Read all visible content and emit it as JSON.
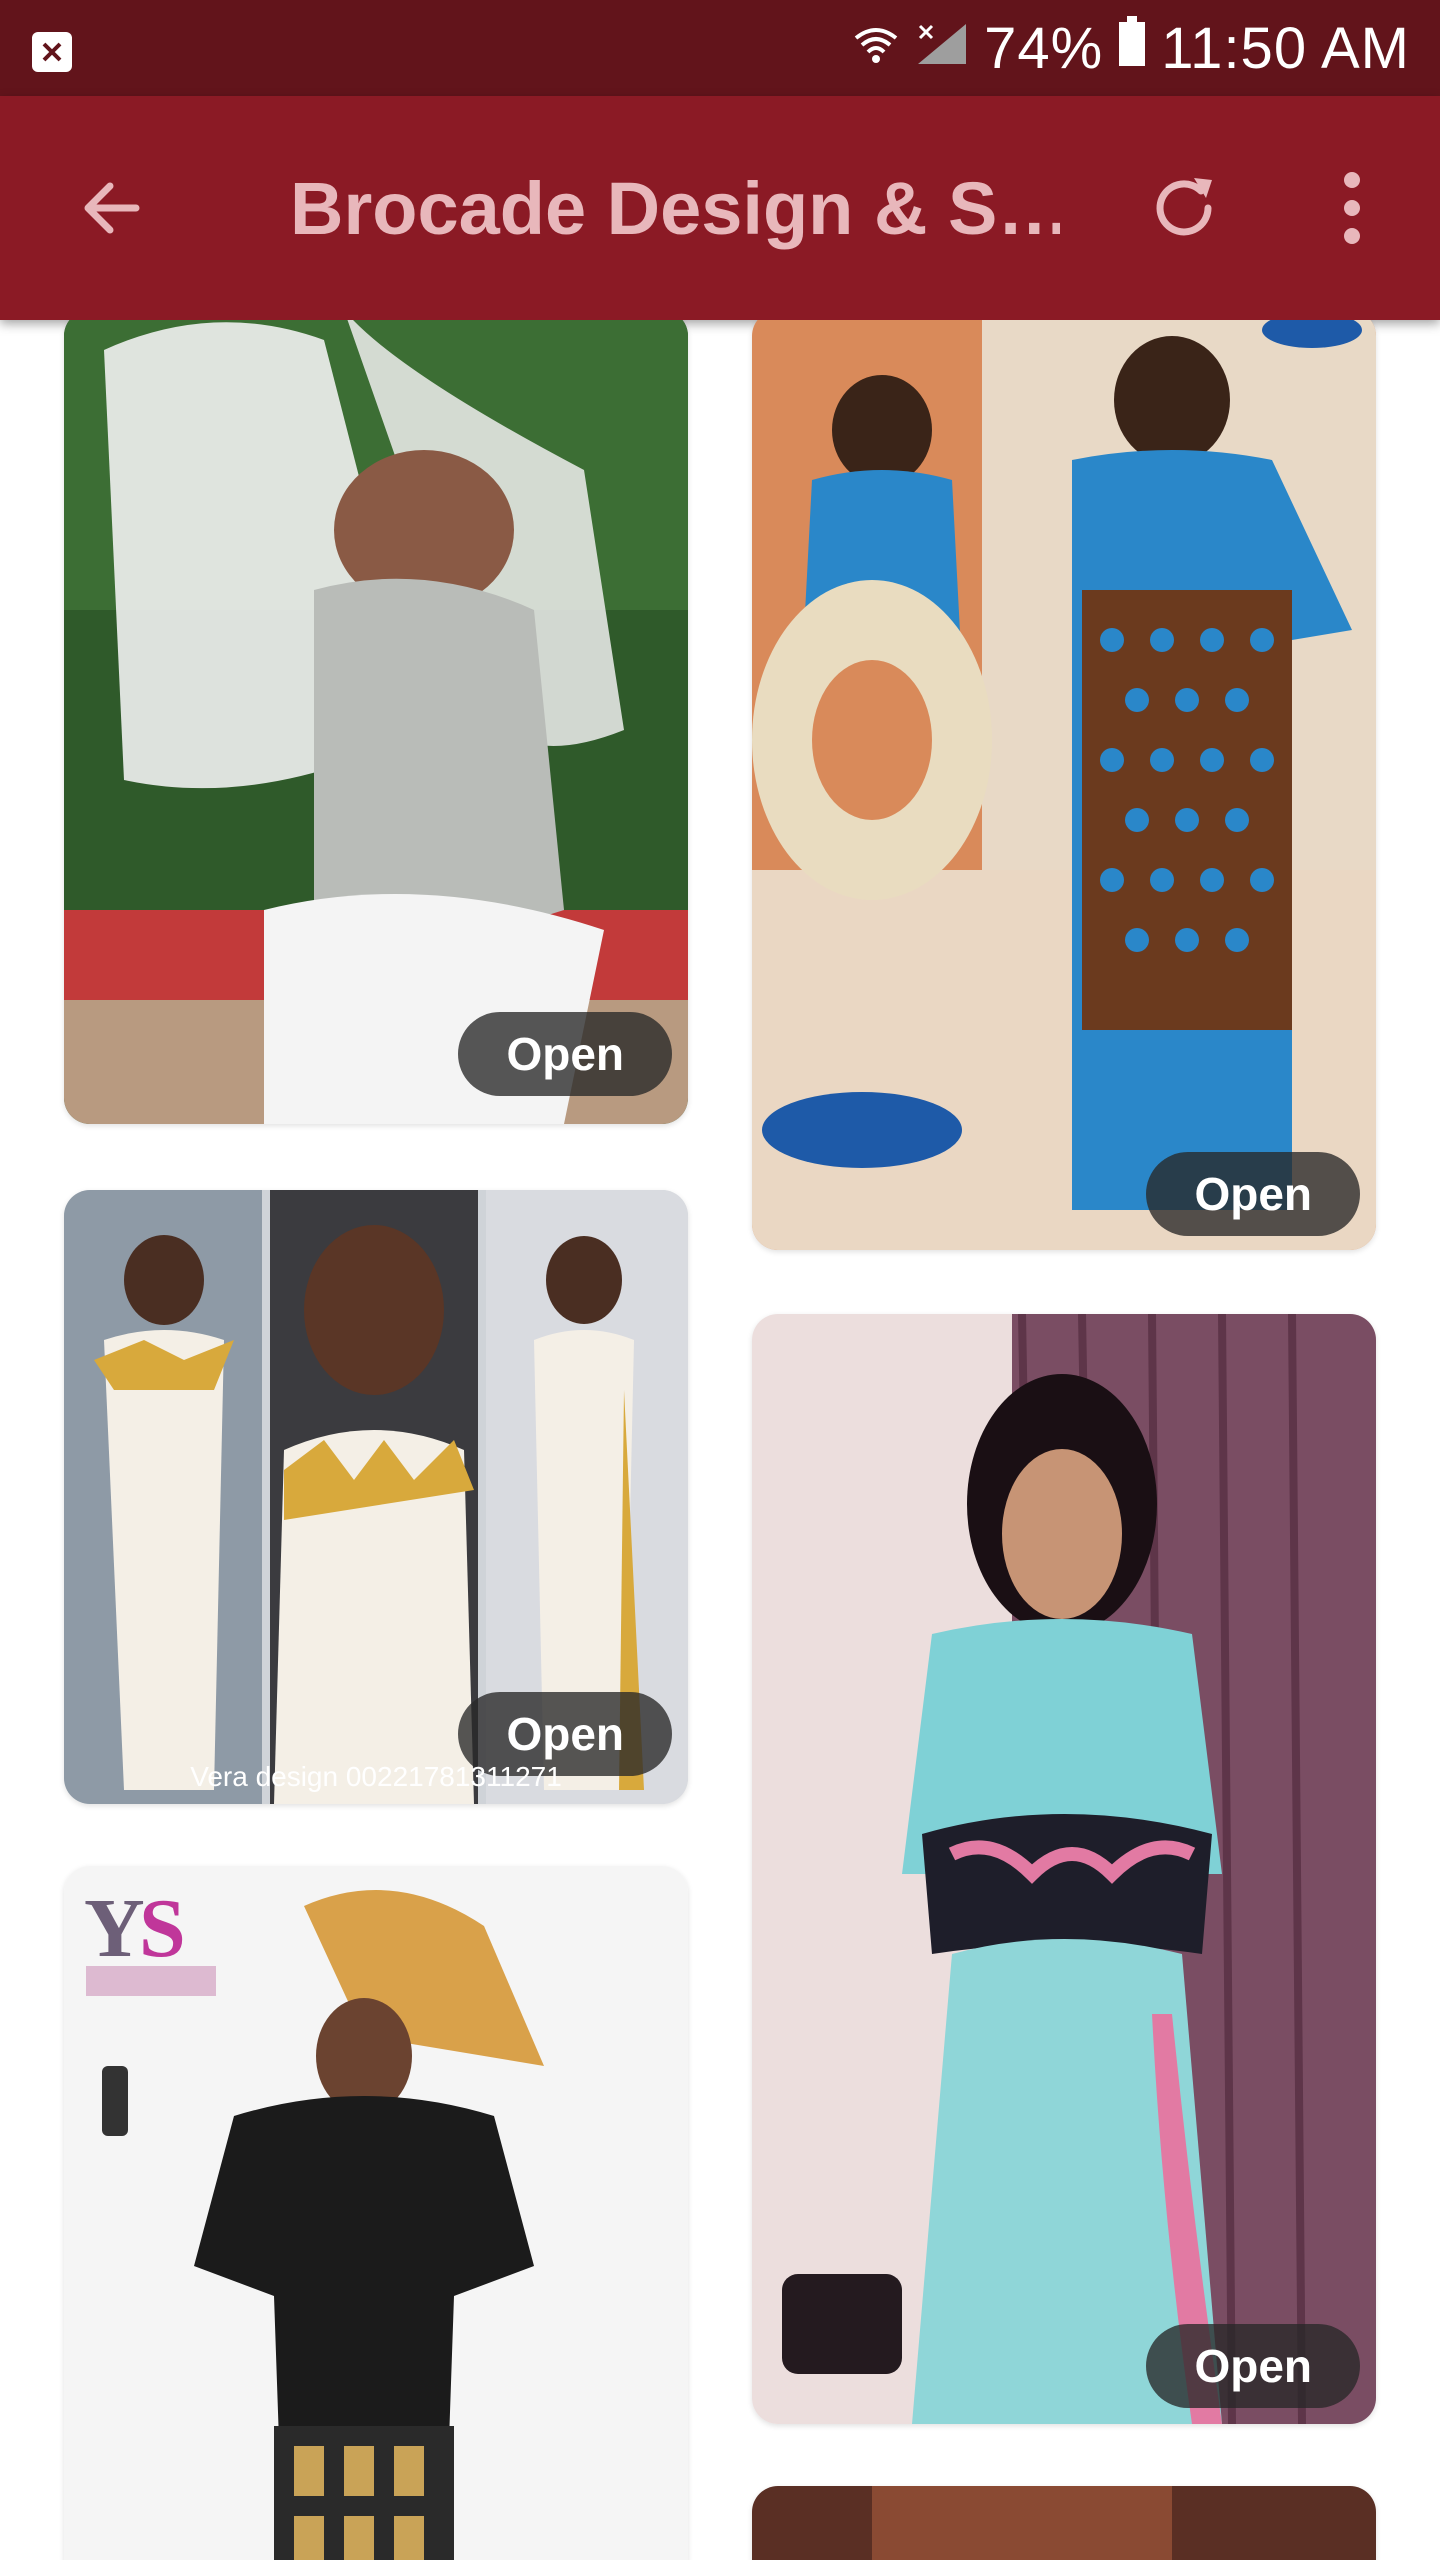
{
  "status_bar": {
    "battery": "74%",
    "time": "11:50 AM",
    "icons": [
      "notification-icon",
      "wifi-icon",
      "signal-icon",
      "battery-icon"
    ]
  },
  "app_bar": {
    "title": "Brocade Design & S…",
    "icons": [
      "back-arrow-icon",
      "refresh-icon",
      "more-vert-icon"
    ]
  },
  "gallery": {
    "open_label": "Open",
    "captions": {
      "card_2": "Vera design 00221781311271"
    }
  },
  "colors": {
    "status_bar": "#62141b",
    "app_bar": "#8b1a25",
    "title_text": "#e8b7bb"
  }
}
